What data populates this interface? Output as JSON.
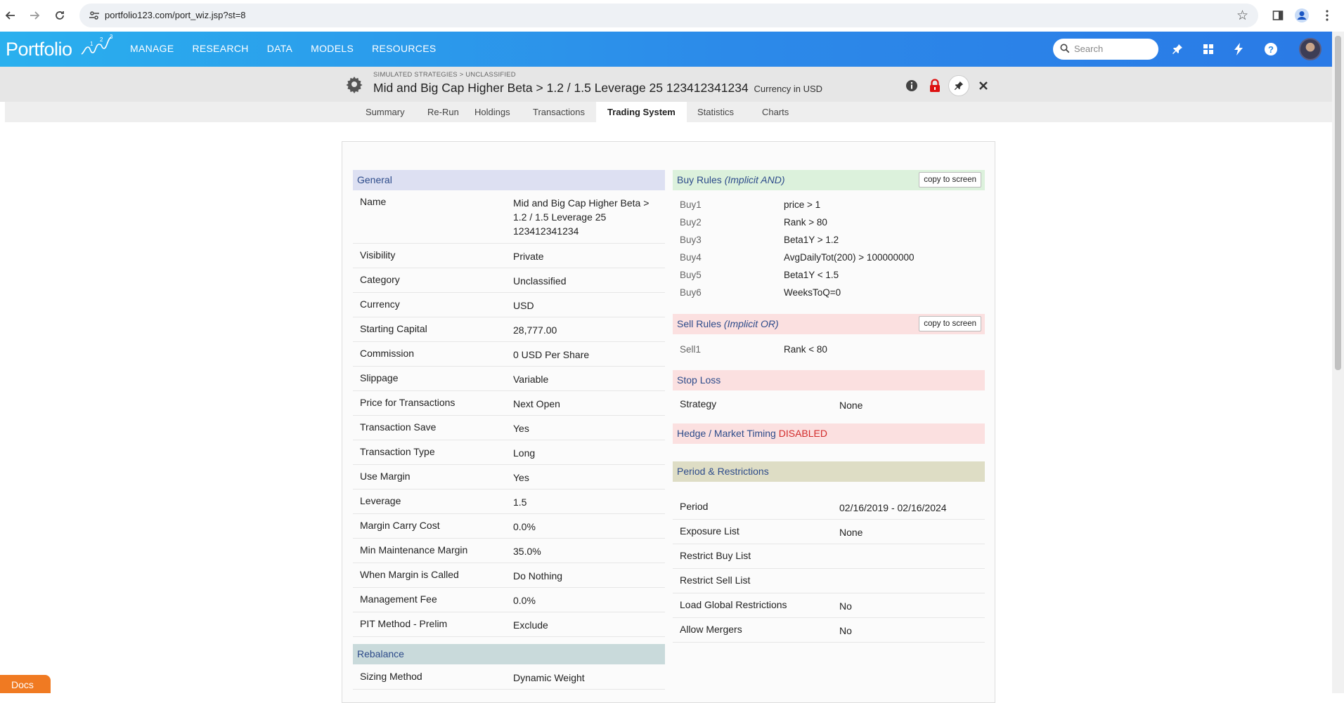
{
  "browser": {
    "url": "portfolio123.com/port_wiz.jsp?st=8"
  },
  "app": {
    "logo_text": "Portfolio",
    "menu": [
      "MANAGE",
      "RESEARCH",
      "DATA",
      "MODELS",
      "RESOURCES"
    ],
    "search_placeholder": "Search"
  },
  "strategy": {
    "breadcrumb": "SIMULATED STRATEGIES > UNCLASSIFIED",
    "title": "Mid and Big Cap Higher Beta > 1.2 / 1.5 Leverage 25 123412341234",
    "currency_note": "Currency in USD"
  },
  "tabs": [
    "Summary",
    "Re-Run",
    "Holdings",
    "Transactions",
    "Trading System",
    "Statistics",
    "Charts"
  ],
  "active_tab": "Trading System",
  "general": {
    "heading": "General",
    "rows": [
      {
        "label": "Name",
        "value": "Mid and Big Cap Higher Beta > 1.2 / 1.5 Leverage 25 123412341234"
      },
      {
        "label": "Visibility",
        "value": "Private"
      },
      {
        "label": "Category",
        "value": "Unclassified"
      },
      {
        "label": "Currency",
        "value": "USD"
      },
      {
        "label": "Starting Capital",
        "value": "28,777.00"
      },
      {
        "label": "Commission",
        "value": "0 USD Per Share"
      },
      {
        "label": "Slippage",
        "value": "Variable"
      },
      {
        "label": "Price for Transactions",
        "value": "Next Open"
      },
      {
        "label": "Transaction Save",
        "value": "Yes"
      },
      {
        "label": "Transaction Type",
        "value": "Long"
      },
      {
        "label": "Use Margin",
        "value": "Yes"
      },
      {
        "label": "Leverage",
        "value": "1.5"
      },
      {
        "label": "Margin Carry Cost",
        "value": "0.0%"
      },
      {
        "label": "Min Maintenance Margin",
        "value": "35.0%"
      },
      {
        "label": "When Margin is Called",
        "value": "Do Nothing"
      },
      {
        "label": "Management Fee",
        "value": "0.0%"
      },
      {
        "label": "PIT Method - Prelim",
        "value": "Exclude"
      }
    ]
  },
  "rebalance": {
    "heading": "Rebalance",
    "rows": [
      {
        "label": "Sizing Method",
        "value": "Dynamic Weight"
      }
    ]
  },
  "buy_rules": {
    "heading": "Buy Rules",
    "qualifier": "(Implicit AND)",
    "copy_label": "copy to screen",
    "rules": [
      {
        "label": "Buy1",
        "value": "price > 1"
      },
      {
        "label": "Buy2",
        "value": "Rank > 80"
      },
      {
        "label": "Buy3",
        "value": "Beta1Y > 1.2"
      },
      {
        "label": "Buy4",
        "value": "AvgDailyTot(200) > 100000000"
      },
      {
        "label": "Buy5",
        "value": "Beta1Y < 1.5"
      },
      {
        "label": "Buy6",
        "value": "WeeksToQ=0"
      }
    ]
  },
  "sell_rules": {
    "heading": "Sell Rules",
    "qualifier": "(Implicit OR)",
    "copy_label": "copy to screen",
    "rules": [
      {
        "label": "Sell1",
        "value": "Rank < 80"
      }
    ]
  },
  "stop_loss": {
    "heading": "Stop Loss",
    "rows": [
      {
        "label": "Strategy",
        "value": "None"
      }
    ]
  },
  "hedge": {
    "heading": "Hedge / Market Timing",
    "status": "DISABLED"
  },
  "period": {
    "heading": "Period & Restrictions",
    "rows": [
      {
        "label": "Period",
        "value": "02/16/2019 - 02/16/2024"
      },
      {
        "label": "Exposure List",
        "value": "None"
      },
      {
        "label": "Restrict Buy List",
        "value": ""
      },
      {
        "label": "Restrict Sell List",
        "value": ""
      },
      {
        "label": "Load Global Restrictions",
        "value": "No"
      },
      {
        "label": "Allow Mergers",
        "value": "No"
      }
    ]
  },
  "docs_label": "Docs",
  "colors": {
    "appbar_start": "#2ab0ee",
    "appbar_end": "#2a7ae6",
    "disabled_red": "#d22b2b",
    "docs_orange": "#f07a22"
  },
  "icons": [
    "back-arrow-icon",
    "forward-arrow-icon",
    "reload-icon",
    "site-settings-icon",
    "bookmark-star-icon",
    "sidepanel-icon",
    "profile-icon",
    "kebab-menu-icon",
    "search-icon",
    "pin-icon",
    "grid-apps-icon",
    "bolt-icon",
    "help-icon",
    "gear-icon",
    "info-icon",
    "lock-icon",
    "close-icon"
  ]
}
